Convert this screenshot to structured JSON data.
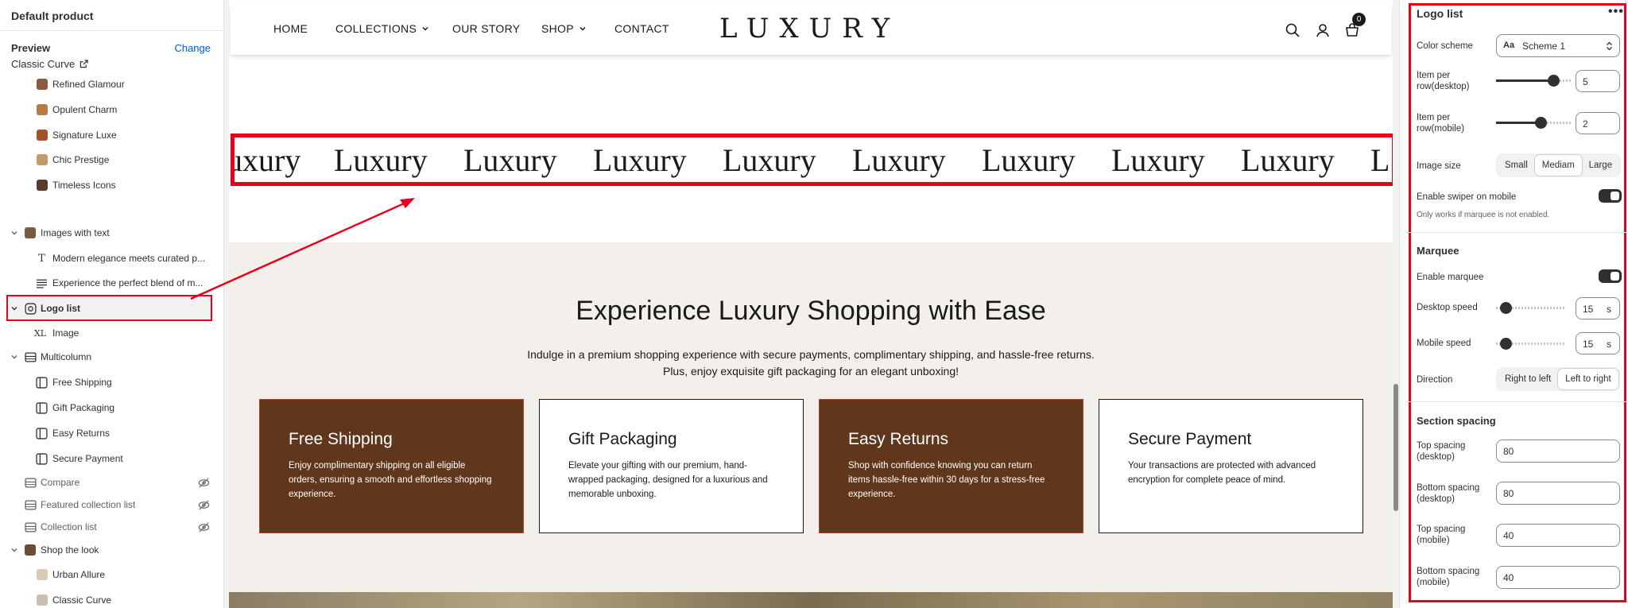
{
  "left": {
    "title": "Default product",
    "preview_label": "Preview",
    "change_label": "Change",
    "preview_name": "Classic Curve",
    "items": [
      {
        "label": "Refined Glamour"
      },
      {
        "label": "Opulent Charm"
      },
      {
        "label": "Signature Luxe"
      },
      {
        "label": "Chic Prestige"
      },
      {
        "label": "Timeless Icons"
      },
      {
        "label": "Images with text"
      },
      {
        "label": "Modern elegance meets curated p..."
      },
      {
        "label": "Experience the perfect blend of m..."
      },
      {
        "label": "Logo list"
      },
      {
        "label": "Image"
      },
      {
        "label": "Multicolumn"
      },
      {
        "label": "Free Shipping"
      },
      {
        "label": "Gift Packaging"
      },
      {
        "label": "Easy Returns"
      },
      {
        "label": "Secure Payment"
      },
      {
        "label": "Compare"
      },
      {
        "label": "Featured collection list"
      },
      {
        "label": "Collection list"
      },
      {
        "label": "Shop the look"
      },
      {
        "label": "Urban Allure"
      },
      {
        "label": "Classic Curve"
      }
    ]
  },
  "store": {
    "nav": [
      "HOME",
      "COLLECTIONS",
      "OUR STORY",
      "SHOP",
      "CONTACT"
    ],
    "brand": "LUXURY",
    "cart_count": "0",
    "marquee_first": "uxury",
    "marquee_word": "Luxury",
    "marquee_last": "L",
    "multicolumn": {
      "title": "Experience Luxury Shopping with Ease",
      "desc_line1": "Indulge in a premium shopping experience with secure payments, complimentary shipping, and hassle-free returns.",
      "desc_line2": "Plus, enjoy exquisite gift packaging for an elegant unboxing!",
      "cards": [
        {
          "title": "Free Shipping",
          "text": "Enjoy complimentary shipping on all eligible orders, ensuring a smooth and effortless shopping experience."
        },
        {
          "title": "Gift Packaging",
          "text": "Elevate your gifting with our premium, hand-wrapped packaging, designed for a luxurious and memorable unboxing."
        },
        {
          "title": "Easy Returns",
          "text": "Shop with confidence knowing you can return items hassle-free within 30 days for a stress-free experience."
        },
        {
          "title": "Secure Payment",
          "text": "Your transactions are protected with advanced encryption for complete peace of mind."
        }
      ]
    }
  },
  "settings": {
    "title": "Logo list",
    "more": "•••",
    "color_scheme_label": "Color scheme",
    "color_scheme_value": "Scheme 1",
    "item_desktop_label": "Item per row(desktop)",
    "item_desktop_value": "5",
    "item_desktop_level": 0.8,
    "item_mobile_label": "Item per row(mobile)",
    "item_mobile_value": "2",
    "item_mobile_level": 0.6,
    "image_size_label": "Image size",
    "image_size_options": [
      "Small",
      "Mediam",
      "Large"
    ],
    "image_size_selected": "Mediam",
    "swiper_label": "Enable swiper on mobile",
    "swiper_help": "Only works if marquee is not enabled.",
    "marquee_heading": "Marquee",
    "enable_marquee_label": "Enable marquee",
    "desktop_speed_label": "Desktop speed",
    "desktop_speed_value": "15",
    "mobile_speed_label": "Mobile speed",
    "mobile_speed_value": "15",
    "speed_unit": "s",
    "direction_label": "Direction",
    "direction_options": [
      "Right to left",
      "Left to right"
    ],
    "direction_selected": "Left to right",
    "spacing_heading": "Section spacing",
    "top_desktop_label": "Top spacing (desktop)",
    "top_desktop_value": "80",
    "bottom_desktop_label": "Bottom spacing (desktop)",
    "bottom_desktop_value": "80",
    "top_mobile_label": "Top spacing (mobile)",
    "top_mobile_value": "40",
    "bottom_mobile_label": "Bottom spacing (mobile)",
    "bottom_mobile_value": "40"
  },
  "colors": {
    "accent_red": "#e5001c",
    "card_brown": "#60371c",
    "link_blue": "#005bd3",
    "beige": "#f3efeb"
  }
}
